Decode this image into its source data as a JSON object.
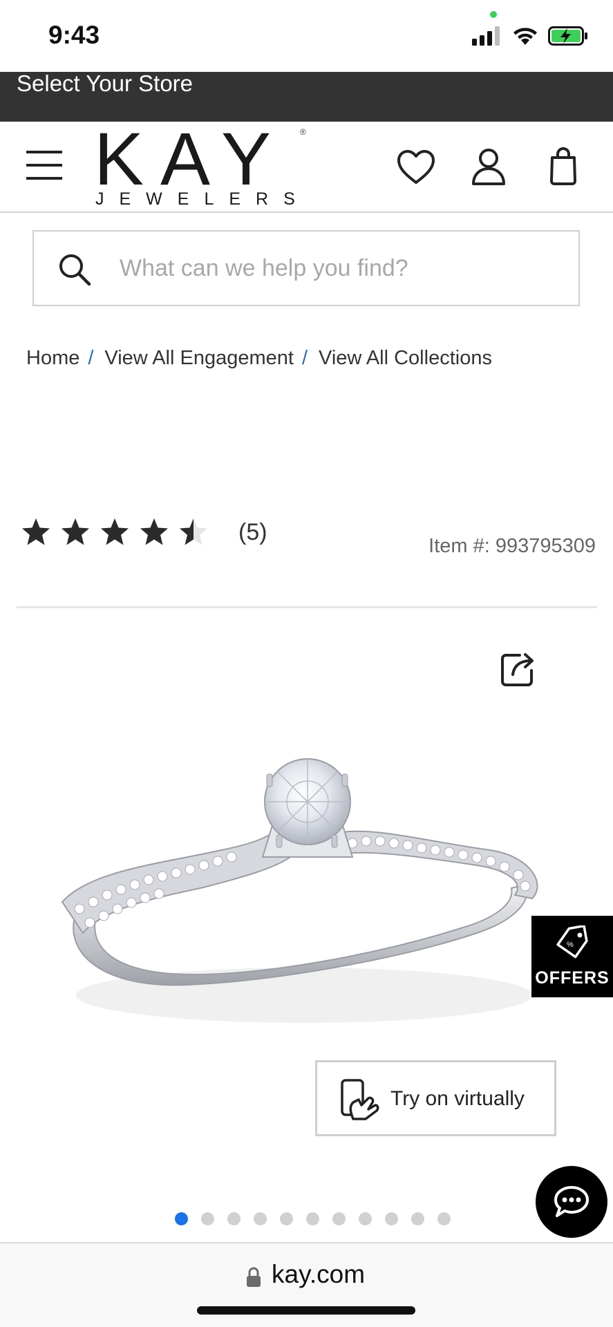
{
  "status_bar": {
    "time": "9:43"
  },
  "store_banner": {
    "label": "Select Your Store"
  },
  "header": {
    "logo_main": "KAY",
    "logo_sub": "JEWELERS",
    "logo_mark": "®",
    "icons": [
      "menu-icon",
      "heart-icon",
      "account-icon",
      "shopping-bag-icon"
    ]
  },
  "search": {
    "placeholder": "What can we help you find?"
  },
  "breadcrumb": {
    "items": [
      "Home",
      "View All Engagement",
      "View All Collections"
    ],
    "separator": "/"
  },
  "rating": {
    "stars": 4.5,
    "max_stars": 5,
    "count": "(5)"
  },
  "item_number": "Item #: 993795309",
  "offers": {
    "label": "OFFERS"
  },
  "try_on": {
    "label": "Try on virtually"
  },
  "carousel": {
    "total": 11,
    "active_index": 0
  },
  "browser": {
    "url": "kay.com"
  },
  "colors": {
    "banner": "#333333",
    "active_dot": "#1a73e8",
    "breadcrumb_separator": "#2a6db0",
    "battery": "#3ecf5a"
  }
}
